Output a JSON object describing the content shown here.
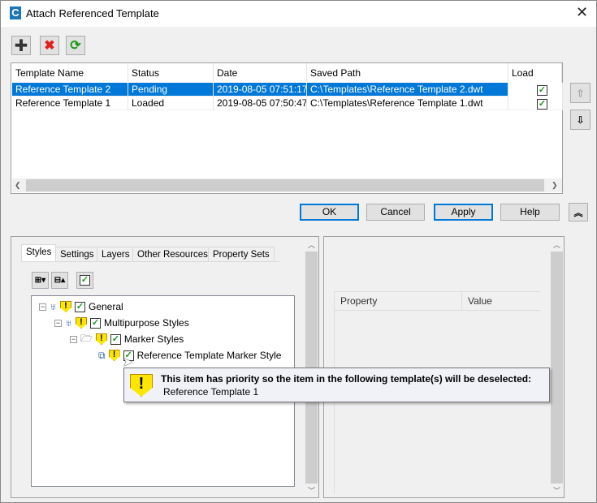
{
  "window": {
    "title": "Attach Referenced Template",
    "app_icon": "autocad-c-icon",
    "close_icon": "close-icon"
  },
  "toolbar": {
    "add_icon": "plus-icon",
    "remove_icon": "red-x-icon",
    "refresh_icon": "refresh-icon"
  },
  "table": {
    "columns": [
      "Template Name",
      "Status",
      "Date",
      "Saved Path",
      "Load"
    ],
    "rows": [
      {
        "name": "Reference Template 2",
        "status": "Pending",
        "date": "2019-08-05 07:51:17",
        "path": "C:\\Templates\\Reference Template 2.dwt",
        "load": true,
        "selected": true
      },
      {
        "name": "Reference Template 1",
        "status": "Loaded",
        "date": "2019-08-05 07:50:47",
        "path": "C:\\Templates\\Reference Template 1.dwt",
        "load": true,
        "selected": false
      }
    ]
  },
  "buttons": {
    "ok": "OK",
    "cancel": "Cancel",
    "apply": "Apply",
    "help": "Help"
  },
  "tabs": [
    "Styles",
    "Settings",
    "Layers",
    "Other Resources",
    "Property Sets"
  ],
  "active_tab": "Styles",
  "tree": [
    {
      "label": "General",
      "checked": true
    },
    {
      "label": "Multipurpose Styles",
      "checked": true
    },
    {
      "label": "Marker Styles",
      "checked": true
    },
    {
      "label": "Reference Template Marker Style",
      "checked": true
    }
  ],
  "property_grid": {
    "columns": [
      "Property",
      "Value"
    ]
  },
  "tooltip": {
    "title": "This item has priority so the item in the following template(s) will be deselected:",
    "detail": "Reference Template 1"
  },
  "colors": {
    "selection": "#0078d7",
    "warning": "#ffe600",
    "check": "#1a9a1a"
  }
}
